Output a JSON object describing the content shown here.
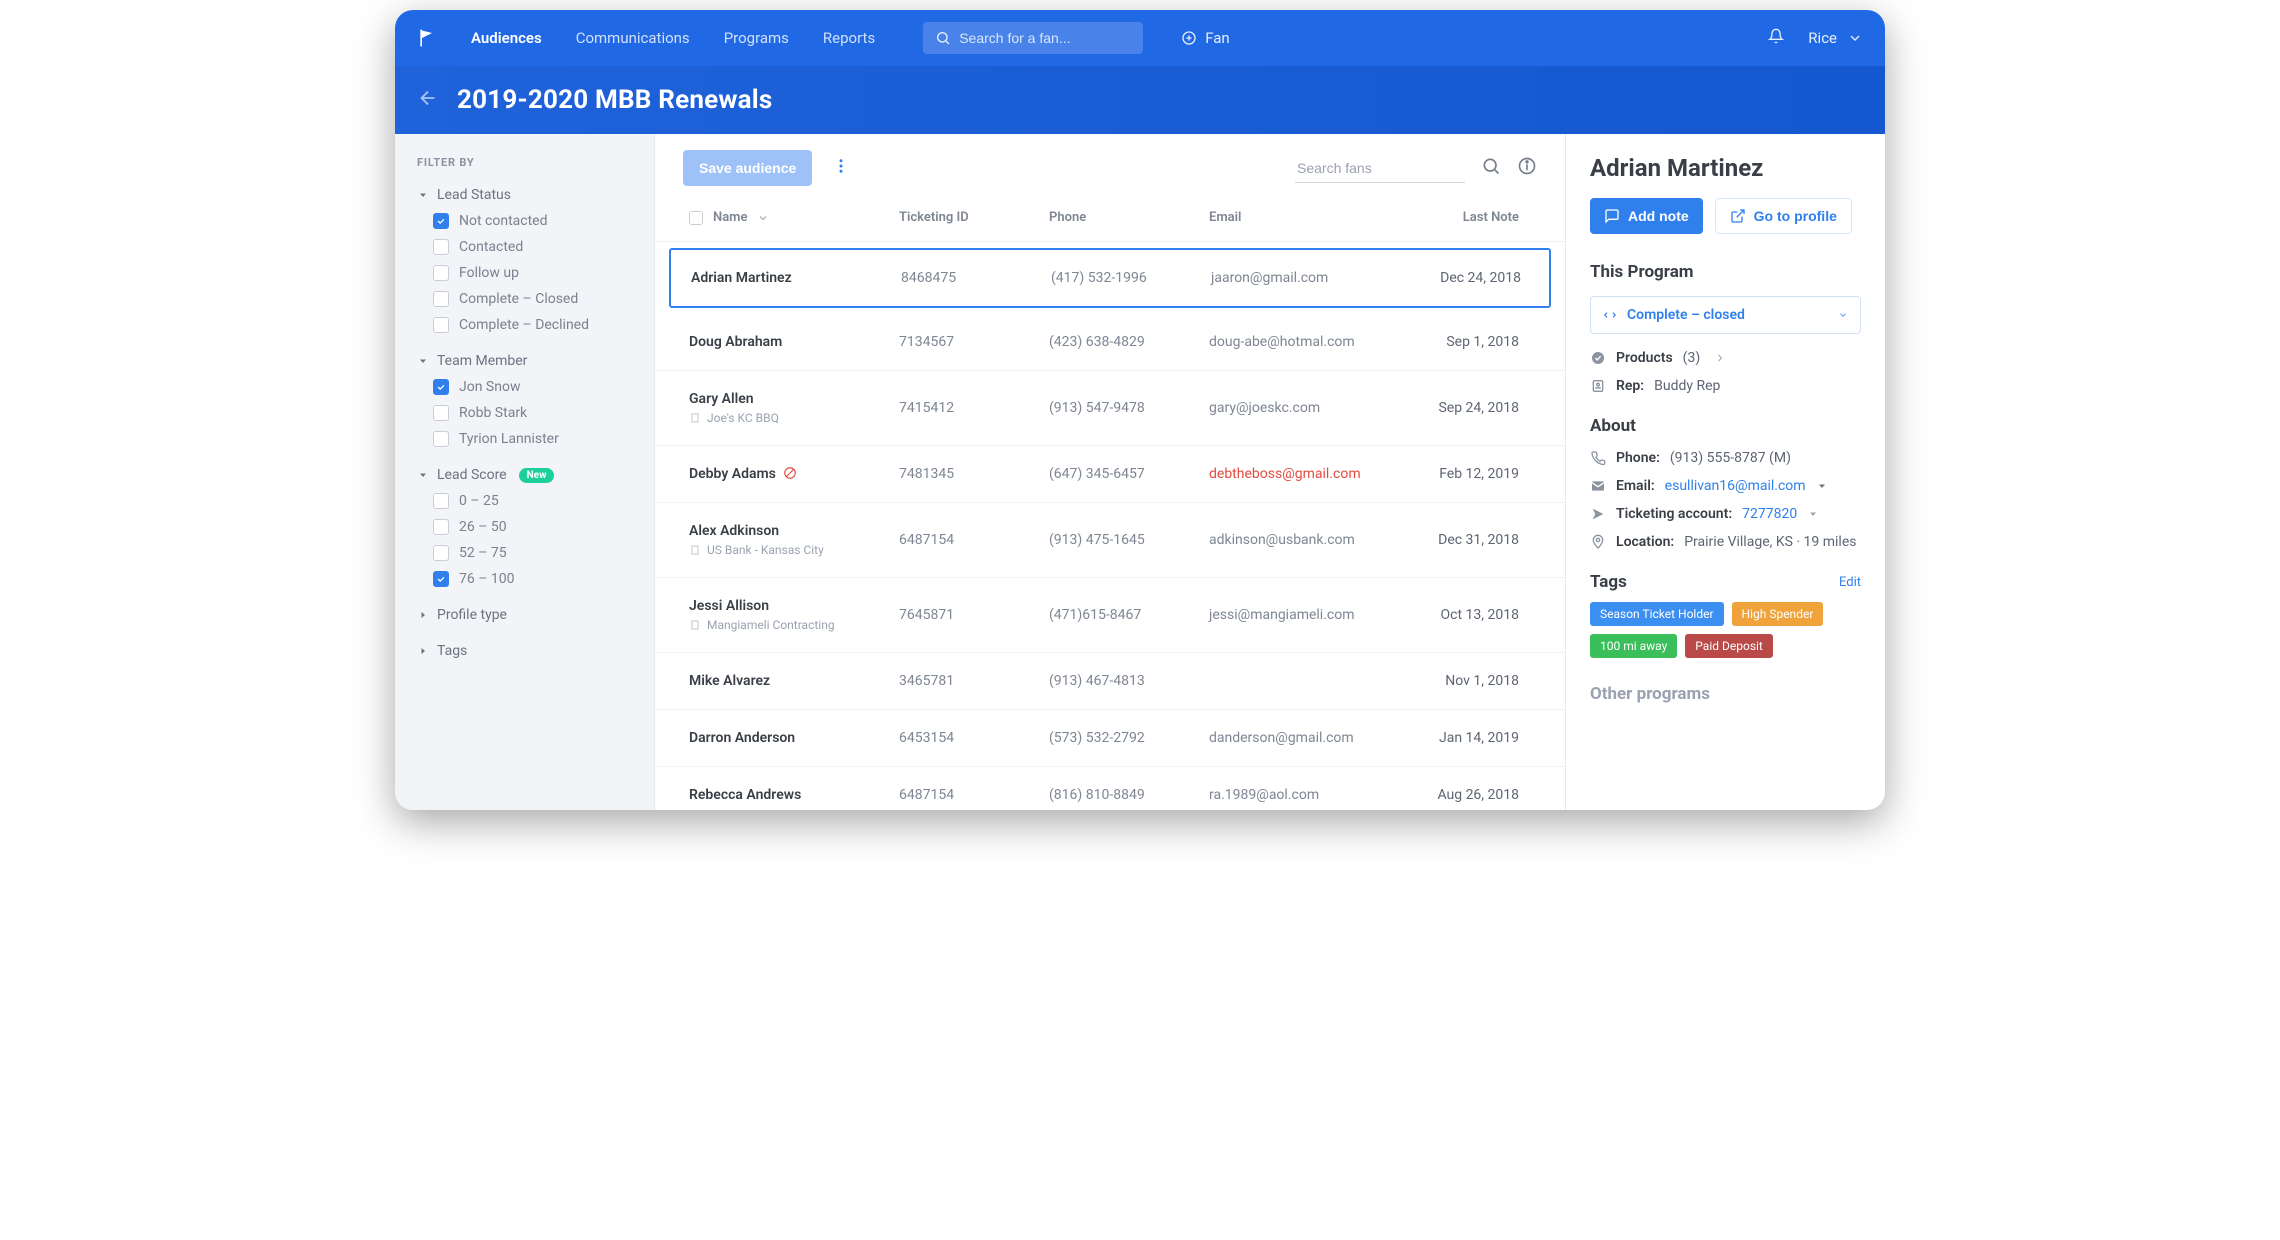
{
  "nav": {
    "links": [
      "Audiences",
      "Communications",
      "Programs",
      "Reports"
    ],
    "active_index": 0,
    "search_placeholder": "Search for a fan...",
    "add_label": "Fan",
    "user_name": "Rice"
  },
  "page": {
    "title": "2019-2020 MBB Renewals"
  },
  "filters": {
    "title": "FILTER BY",
    "groups": [
      {
        "label": "Lead Status",
        "expanded": true,
        "items": [
          {
            "label": "Not contacted",
            "checked": true
          },
          {
            "label": "Contacted",
            "checked": false
          },
          {
            "label": "Follow up",
            "checked": false
          },
          {
            "label": "Complete – Closed",
            "checked": false
          },
          {
            "label": "Complete – Declined",
            "checked": false
          }
        ]
      },
      {
        "label": "Team Member",
        "expanded": true,
        "items": [
          {
            "label": "Jon Snow",
            "checked": true
          },
          {
            "label": "Robb Stark",
            "checked": false
          },
          {
            "label": "Tyrion Lannister",
            "checked": false
          }
        ]
      },
      {
        "label": "Lead Score",
        "expanded": true,
        "badge": "New",
        "items": [
          {
            "label": "0 – 25",
            "checked": false
          },
          {
            "label": "26 – 50",
            "checked": false
          },
          {
            "label": "52 – 75",
            "checked": false
          },
          {
            "label": "76 – 100",
            "checked": true
          }
        ]
      },
      {
        "label": "Profile type",
        "expanded": false,
        "items": []
      },
      {
        "label": "Tags",
        "expanded": false,
        "items": []
      }
    ]
  },
  "toolbar": {
    "save_label": "Save audience",
    "search_placeholder": "Search fans"
  },
  "table": {
    "columns": [
      "Name",
      "Ticketing ID",
      "Phone",
      "Email",
      "Last Note"
    ],
    "rows": [
      {
        "name": "Adrian Martinez",
        "ticketing_id": "8468475",
        "phone": "(417) 532-1996",
        "email": "jaaron@gmail.com",
        "last_note": "Dec 24, 2018",
        "selected": true
      },
      {
        "name": "Doug Abraham",
        "ticketing_id": "7134567",
        "phone": "(423) 638-4829",
        "email": "doug-abe@hotmal.com",
        "last_note": "Sep 1, 2018"
      },
      {
        "name": "Gary Allen",
        "company": "Joe's KC BBQ",
        "ticketing_id": "7415412",
        "phone": "(913) 547-9478",
        "email": "gary@joeskc.com",
        "last_note": "Sep 24, 2018"
      },
      {
        "name": "Debby Adams",
        "blocked": true,
        "ticketing_id": "7481345",
        "phone": "(647) 345-6457",
        "email": "debtheboss@gmail.com",
        "email_error": true,
        "last_note": "Feb 12, 2019"
      },
      {
        "name": "Alex Adkinson",
        "company": "US Bank - Kansas City",
        "ticketing_id": "6487154",
        "phone": "(913) 475-1645",
        "email": "adkinson@usbank.com",
        "last_note": "Dec 31, 2018"
      },
      {
        "name": "Jessi Allison",
        "company": "Mangiameli Contracting",
        "ticketing_id": "7645871",
        "phone": "(471)615-8467",
        "email": "jessi@mangiameli.com",
        "last_note": "Oct 13, 2018"
      },
      {
        "name": "Mike Alvarez",
        "ticketing_id": "3465781",
        "phone": "(913) 467-4813",
        "email": "",
        "last_note": "Nov 1, 2018"
      },
      {
        "name": "Darron Anderson",
        "ticketing_id": "6453154",
        "phone": "(573) 532-2792",
        "email": "danderson@gmail.com",
        "last_note": "Jan 14, 2019"
      },
      {
        "name": "Rebecca Andrews",
        "ticketing_id": "6487154",
        "phone": "(816) 810-8849",
        "email": "ra.1989@aol.com",
        "last_note": "Aug 26, 2018"
      }
    ]
  },
  "detail": {
    "name": "Adrian Martinez",
    "add_note_label": "Add note",
    "go_profile_label": "Go to profile",
    "program": {
      "title": "This Program",
      "status": "Complete – closed",
      "products_label": "Products",
      "products_count": "(3)",
      "rep_label": "Rep:",
      "rep_value": "Buddy Rep"
    },
    "about": {
      "title": "About",
      "phone_label": "Phone:",
      "phone_value": "(913) 555-8787 (M)",
      "email_label": "Email:",
      "email_value": "esullivan16@mail.com",
      "ticketing_label": "Ticketing account:",
      "ticketing_value": "7277820",
      "location_label": "Location:",
      "location_value": "Prairie Village, KS · 19 miles"
    },
    "tags": {
      "title": "Tags",
      "edit_label": "Edit",
      "items": [
        {
          "text": "Season Ticket Holder",
          "color": "#3b8ff0"
        },
        {
          "text": "High Spender",
          "color": "#f0a23b"
        },
        {
          "text": "100 mi away",
          "color": "#3bbf5a"
        },
        {
          "text": "Paid Deposit",
          "color": "#b94a48"
        }
      ]
    },
    "other_section_title": "Other programs"
  }
}
